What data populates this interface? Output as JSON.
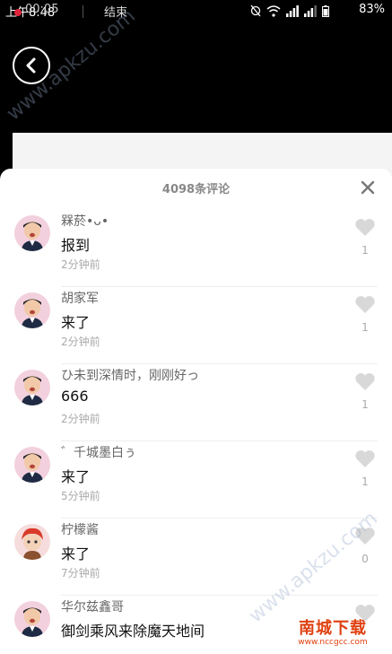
{
  "status_bar": {
    "time": "上午8:48",
    "rec_timer": "00:05",
    "end_label": "结束",
    "battery": "83%"
  },
  "sheet": {
    "title": "4098条评论",
    "comments": [
      {
        "user": "槑菸•ᴗ•",
        "text": "报到",
        "time": "2分钟前",
        "likes": "1"
      },
      {
        "user": "胡家军",
        "text": "来了",
        "time": "2分钟前",
        "likes": "1"
      },
      {
        "user": "ひ未到深情时，刚刚好っ",
        "text": "666",
        "time": "2分钟前",
        "likes": "1"
      },
      {
        "user": "゛千城墨白ぅ",
        "text": "来了",
        "time": "5分钟前",
        "likes": "1"
      },
      {
        "user": "柠檬酱",
        "text": "来了",
        "time": "7分钟前",
        "likes": "0"
      },
      {
        "user": "华尔兹鑫哥",
        "text": "御剑乘风来除魔天地间",
        "time": "",
        "likes": ""
      }
    ]
  },
  "watermark": {
    "text": "www.apkzu.com"
  },
  "logo": {
    "main": "南城下载",
    "sub": "www.nccgcc.com"
  }
}
